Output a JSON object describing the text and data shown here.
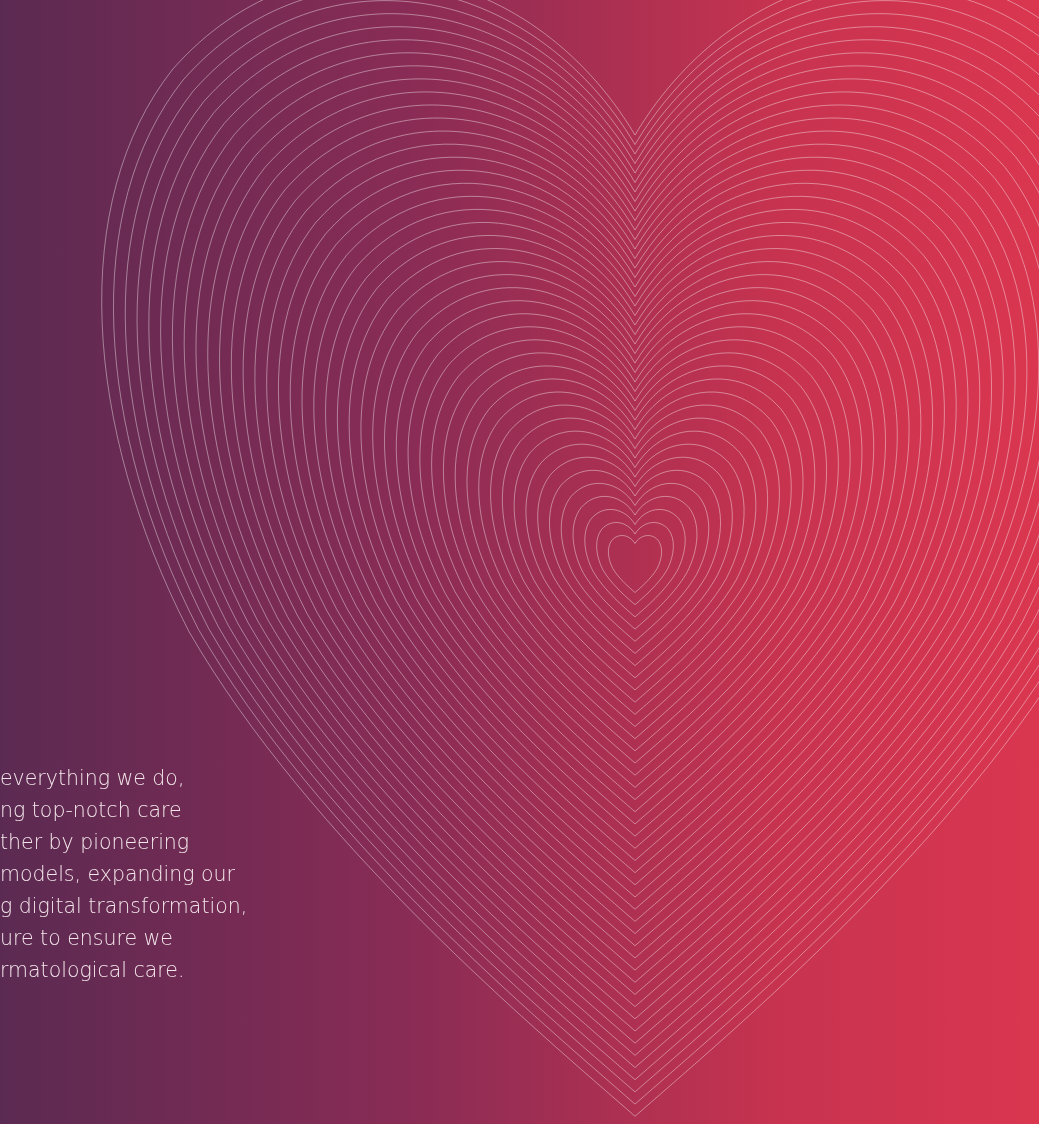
{
  "text_lines": [
    "everything we do,",
    "ng top-notch care",
    "ther by pioneering",
    "models, expanding our",
    "g digital transformation,",
    "ure to ensure we",
    "rmatological care."
  ]
}
